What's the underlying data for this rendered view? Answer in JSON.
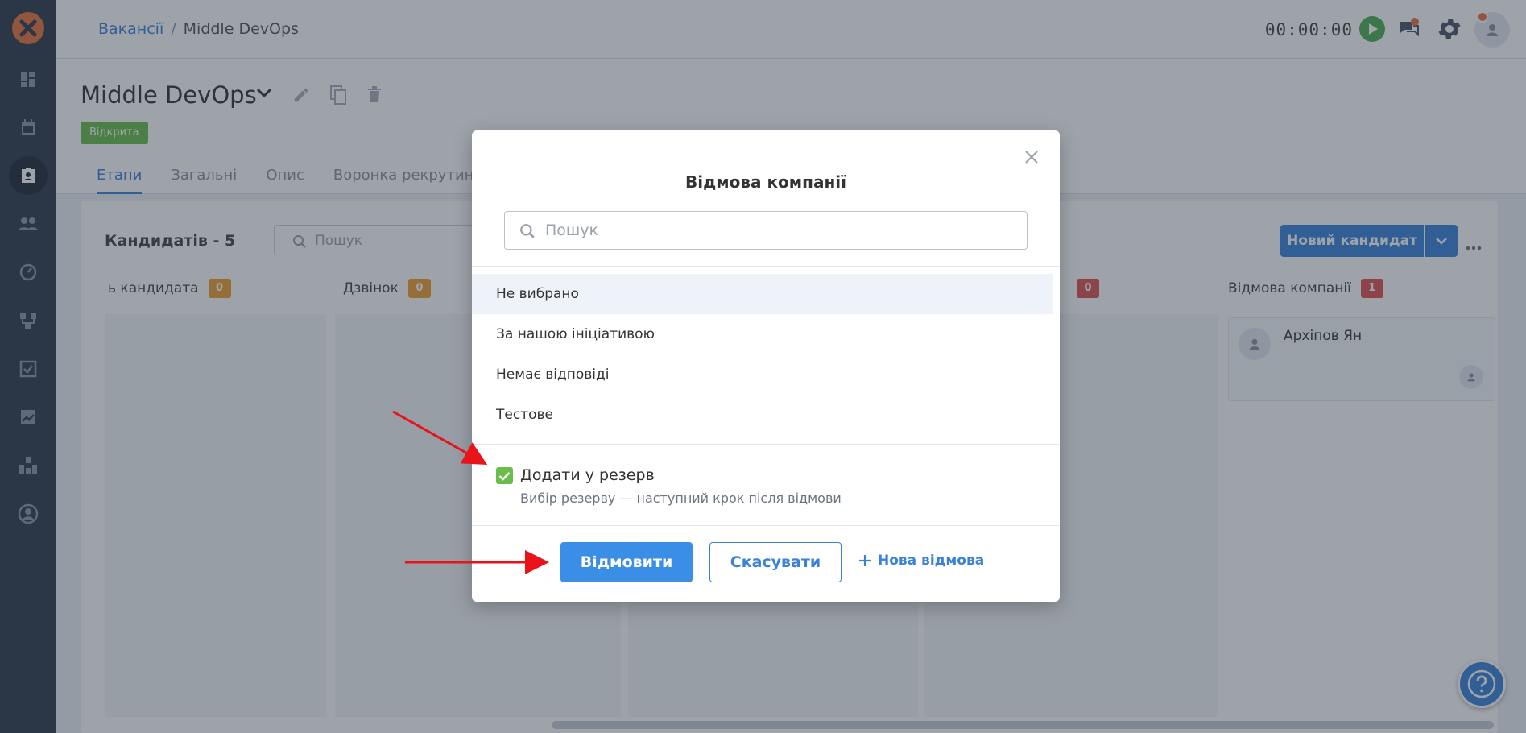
{
  "breadcrumb": {
    "parent": "Вакансії",
    "separator": "/",
    "current": "Middle DevOps"
  },
  "header": {
    "timer": "00:00:00"
  },
  "vacancy": {
    "title": "Middle DevOps",
    "status": "Відкрита"
  },
  "tabs": [
    {
      "label": "Етапи",
      "active": true
    },
    {
      "label": "Загальні"
    },
    {
      "label": "Опис"
    },
    {
      "label": "Воронка рекрутингу"
    }
  ],
  "board": {
    "candidate_count": "Кандидатів - 5",
    "search_placeholder": "Пошук",
    "new_candidate_label": "Новий кандидат",
    "columns": [
      {
        "name": "ь кандидата",
        "count": "0",
        "badge_color": "#f0a030"
      },
      {
        "name": "Дзвінок",
        "count": "0",
        "badge_color": "#f0a030"
      },
      {
        "name": "",
        "count": "0",
        "badge_color": "#e05050"
      },
      {
        "name": "Відмова компанії",
        "count": "1",
        "badge_color": "#e05050"
      }
    ],
    "card": {
      "name": "Архіпов Ян"
    }
  },
  "modal": {
    "title": "Відмова компанії",
    "search_placeholder": "Пошук",
    "options": [
      {
        "label": "Не вибрано",
        "selected": true
      },
      {
        "label": "За нашою ініціативою"
      },
      {
        "label": "Немає відповіді"
      },
      {
        "label": "Тестове"
      }
    ],
    "reserve": {
      "checked": true,
      "label": "Додати у резерв",
      "hint": "Вибір резерву — наступний крок після відмови"
    },
    "reject_label": "Відмовити",
    "cancel_label": "Скасувати",
    "new_reason_label": "Нова відмова"
  },
  "colors": {
    "accent": "#3a82d8",
    "success": "#6bbd4a",
    "sidebar": "#2f3a4c",
    "annotation_arrow": "#e8141a"
  },
  "icons": [
    "logo-icon",
    "dashboard-icon",
    "calendar-icon",
    "vacancies-icon",
    "candidates-icon",
    "speedometer-icon",
    "workflow-icon",
    "tasks-icon",
    "analytics-icon",
    "integrations-icon",
    "profile-icon",
    "play-icon",
    "chat-icon",
    "gear-icon",
    "user-icon",
    "chevron-down-icon",
    "edit-icon",
    "copy-icon",
    "trash-icon",
    "search-icon",
    "sort-icon",
    "filter-icon",
    "more-icon",
    "close-icon",
    "check-icon",
    "plus-icon",
    "help-icon"
  ]
}
